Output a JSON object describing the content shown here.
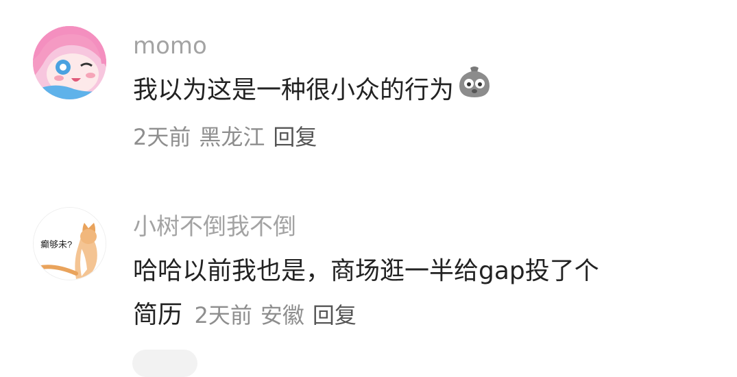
{
  "comments": [
    {
      "username": "momo",
      "text": "我以为这是一种很小众的行为",
      "sticker": "gray-bag-face-icon",
      "time": "2天前",
      "location": "黑龙江",
      "reply_label": "回复"
    },
    {
      "username": "小树不倒我不倒",
      "avatar_caption": "癫够未?",
      "text_line1": "哈哈以前我也是，商场逛一半给gap投了个",
      "text_line2": "简历",
      "time": "2天前",
      "location": "安徽",
      "reply_label": "回复"
    }
  ]
}
